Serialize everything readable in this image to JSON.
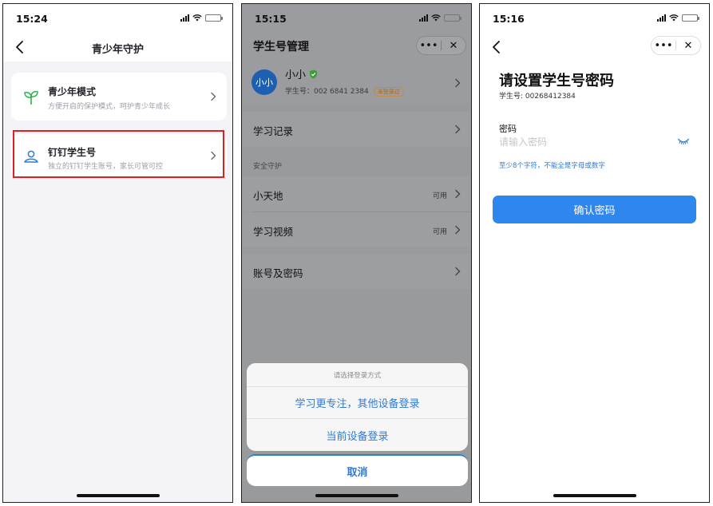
{
  "phone1": {
    "status_time": "15:24",
    "title": "青少年守护",
    "cards": [
      {
        "title": "青少年模式",
        "subtitle": "方便开启的保护模式，呵护青少年成长",
        "icon": "sprout-icon"
      },
      {
        "title": "钉钉学生号",
        "subtitle": "独立的钉钉学生账号，家长可管可控",
        "icon": "student-icon"
      }
    ]
  },
  "phone2": {
    "status_time": "15:15",
    "title": "学生号管理",
    "more_label": "•••",
    "close_label": "✕",
    "profile": {
      "avatar_text": "小小",
      "name": "小小",
      "student_id": "学生号：002 6841 2384",
      "badge": "未登录过"
    },
    "rows": {
      "study_records": "学习记录",
      "section_header": "安全守护",
      "xiaotiandi": "小天地",
      "xiaotiandi_value": "可用",
      "study_video": "学习视频",
      "study_video_value": "可用",
      "account_password": "账号及密码"
    },
    "sheet": {
      "header": "请选择登录方式",
      "option_focus": "学习更专注，其他设备登录",
      "option_current": "当前设备登录",
      "cancel": "取消"
    }
  },
  "phone3": {
    "status_time": "15:16",
    "more_label": "•••",
    "close_label": "✕",
    "title": "请设置学生号密码",
    "student_id": "学生号: 00268412384",
    "password_label": "密码",
    "password_placeholder": "请输入密码",
    "hint": "至少8个字符，不能全是字母或数字",
    "confirm_button": "确认密码"
  },
  "colors": {
    "accent_blue": "#2f86ef",
    "highlight_red": "#e02020",
    "sprout_green": "#2bb24c",
    "badge_orange": "#c98a39"
  }
}
